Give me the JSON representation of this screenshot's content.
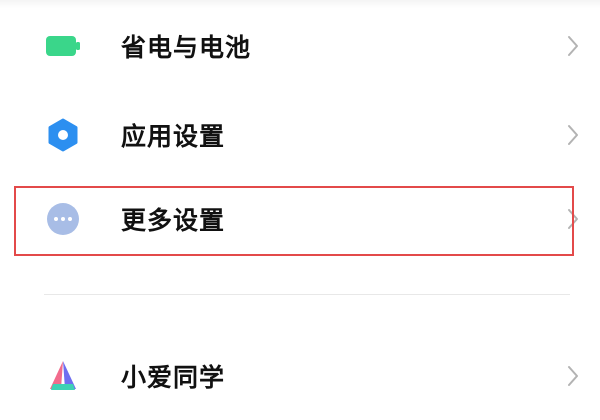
{
  "settings": {
    "items": [
      {
        "label": "省电与电池",
        "icon": "battery-icon",
        "color": "#3ad68a"
      },
      {
        "label": "应用设置",
        "icon": "gear-icon",
        "color": "#2c8ff0"
      },
      {
        "label": "更多设置",
        "icon": "more-dots-icon",
        "color": "#a8bde6"
      },
      {
        "label": "小爱同学",
        "icon": "xiaoai-logo-icon",
        "color": "#6f6ef0"
      }
    ],
    "highlighted_item": "更多设置",
    "highlight_color": "#e34a4a"
  }
}
